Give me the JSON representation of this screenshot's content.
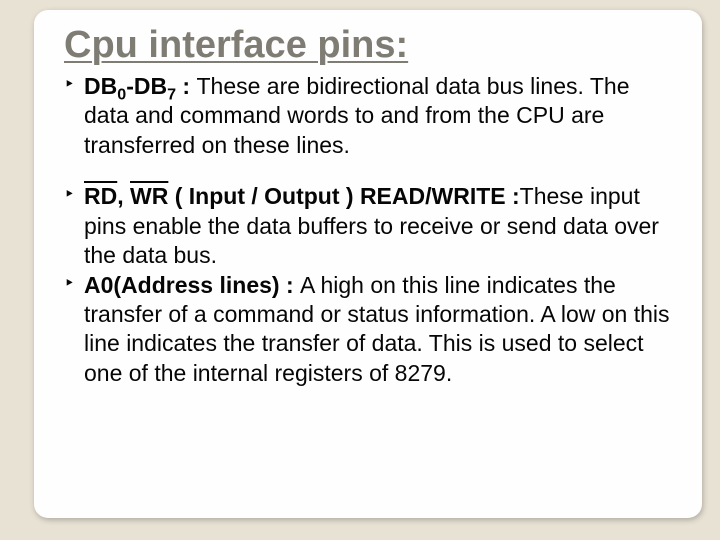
{
  "slide": {
    "title": "Cpu interface pins:",
    "bullets": {
      "b1": {
        "label_pre": "DB",
        "label_sub1": "0",
        "label_mid": "-DB",
        "label_sub2": "7",
        "label_post_bold": " : ",
        "text": "These are bidirectional data bus lines. The data and command words to and from the CPU are transferred on these lines."
      },
      "b2": {
        "label_bold_space": " ",
        "label_rd": "RD",
        "label_sep": ", ",
        "label_wr": "WR",
        "label_io": " ( Input / Output ) READ/WRITE :",
        "text": "These input pins enable the data buffers to receive or send data over the data bus."
      },
      "b3": {
        "label_bold": "A0(Address lines) : ",
        "text": "A high on this line indicates the transfer of a command or status information. A low on this line indicates the transfer of data. This is used to select one of the internal registers of 8279."
      }
    }
  }
}
